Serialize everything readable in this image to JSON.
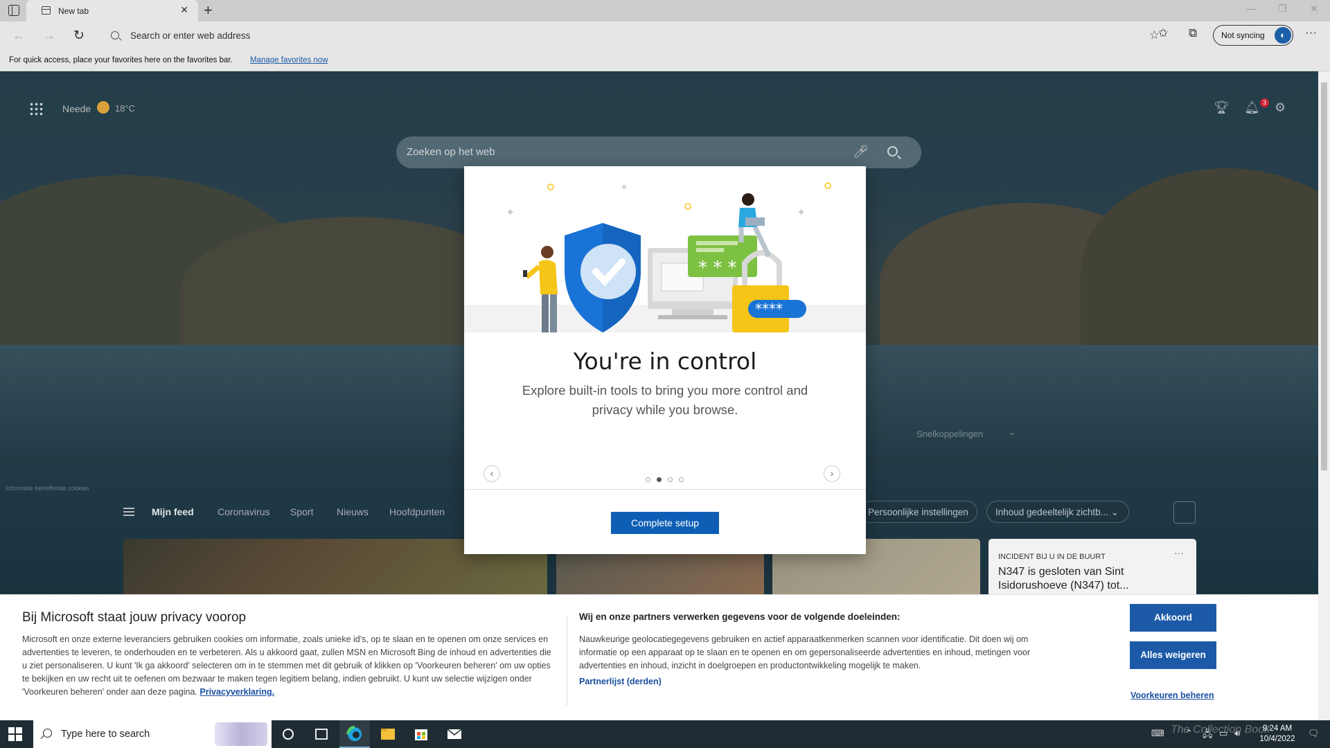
{
  "browser": {
    "tab_title": "New tab",
    "address_placeholder": "Search or enter web address",
    "sync_label": "Not syncing",
    "favorites_bar_message": "For quick access, place your favorites here on the favorites bar.",
    "favorites_bar_link": "Manage favorites now"
  },
  "newtab": {
    "location": "Neede",
    "temperature": "18°C",
    "notification_count": "3",
    "search_placeholder": "Zoeken op het web",
    "quick_links": "Snelkoppelingen",
    "cookie_info": "Informatie betreffende cookies",
    "feed_tabs": [
      "Mijn feed",
      "Coronavirus",
      "Sport",
      "Nieuws",
      "Hoofdpunten"
    ],
    "personal_settings": "Persoonlijke instellingen",
    "content_visibility": "Inhoud gedeeltelijk zichtb...",
    "news_card": {
      "category": "INCIDENT BIJ U IN DE BUURT",
      "title": "N347 is gesloten van Sint Isidorushoeve (N347) tot..."
    }
  },
  "modal": {
    "title": "You're in control",
    "description": "Explore built-in tools to bring you more control and privacy while you browse.",
    "button": "Complete setup",
    "carousel_pages": 4,
    "carousel_current": 2,
    "colors": {
      "button": "#0f5eb6",
      "shield": "#1a73d6",
      "accent_green": "#7dc143",
      "accent_yellow": "#f5c518"
    }
  },
  "cookie_banner": {
    "title": "Bij Microsoft staat jouw privacy voorop",
    "body": "Microsoft en onze externe leveranciers gebruiken cookies om informatie, zoals unieke id's, op te slaan en te openen om onze services en advertenties te leveren, te onderhouden en te verbeteren. Als u akkoord gaat, zullen MSN en Microsoft Bing de inhoud en advertenties die u ziet personaliseren. U kunt 'Ik ga akkoord' selecteren om in te stemmen met dit gebruik of klikken op 'Voorkeuren beheren' om uw opties te bekijken en uw recht uit te oefenen om bezwaar te maken tegen legitiem belang, indien gebruikt. U kunt uw selectie wijzigen onder 'Voorkeuren beheren' onder aan deze pagina.",
    "privacy_link": "Privacyverklaring.",
    "purposes_title": "Wij en onze partners verwerken gegevens voor de volgende doeleinden:",
    "purposes_body": "Nauwkeurige geolocatiegegevens gebruiken en actief apparaatkenmerken scannen voor identificatie. Dit doen wij om informatie op een apparaat op te slaan en te openen en om gepersonaliseerde advertenties en inhoud, metingen voor advertenties en inhoud, inzicht in doelgroepen en productontwikkeling mogelijk te maken.",
    "partner_link": "Partnerlijst (derden)",
    "accept": "Akkoord",
    "reject": "Alles weigeren",
    "manage": "Voorkeuren beheren"
  },
  "taskbar": {
    "search_placeholder": "Type here to search",
    "time": "9:24 AM",
    "date": "10/4/2022",
    "watermark": "The Collection Book"
  }
}
